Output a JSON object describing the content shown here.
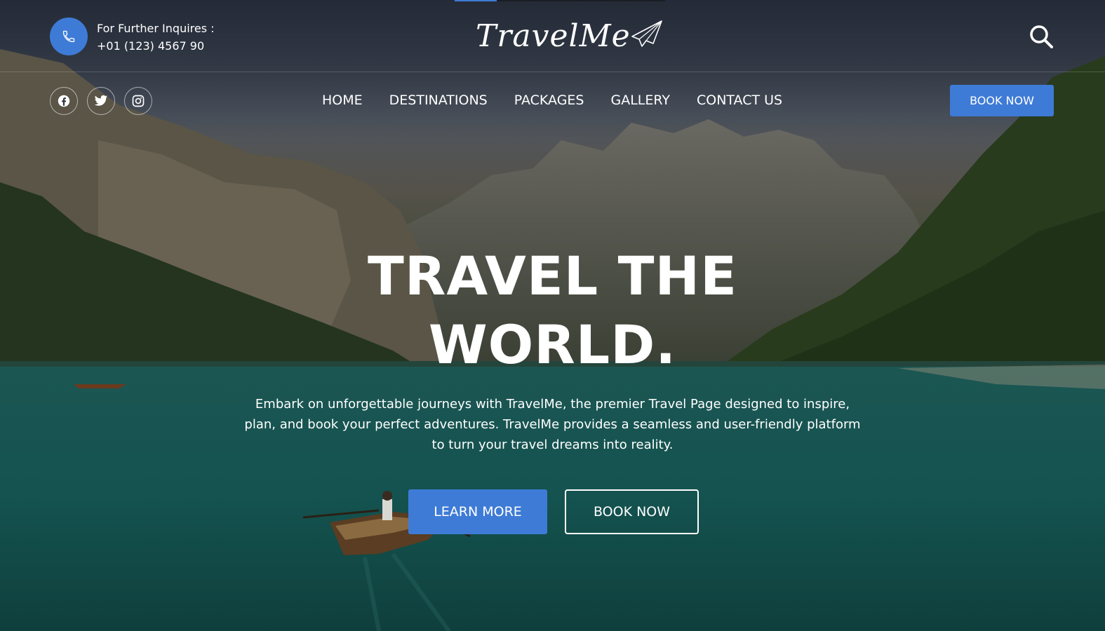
{
  "topbar": {
    "inquiry_label": "For Further Inquires :",
    "phone_number": "+01 (123) 4567 90",
    "logo_text": "TravelMe",
    "slider_progress": 0.2
  },
  "social": {
    "facebook": "facebook-icon",
    "twitter": "twitter-icon",
    "instagram": "instagram-icon"
  },
  "nav": {
    "items": [
      "HOME",
      "DESTINATIONS",
      "PACKAGES",
      "GALLERY",
      "CONTACT US"
    ],
    "book_label": "BOOK NOW"
  },
  "hero": {
    "headline_line1": "TRAVEL THE",
    "headline_line2": "WORLD.",
    "subtitle": "Embark on unforgettable journeys with TravelMe, the premier Travel Page designed to inspire, plan, and book your perfect adventures. TravelMe provides a seamless and user-friendly platform to turn your travel dreams into reality.",
    "learn_more_label": "LEARN MORE",
    "book_now_label": "BOOK NOW"
  },
  "colors": {
    "accent": "#3e7bd6",
    "text": "#ffffff",
    "lake": "#124441"
  }
}
